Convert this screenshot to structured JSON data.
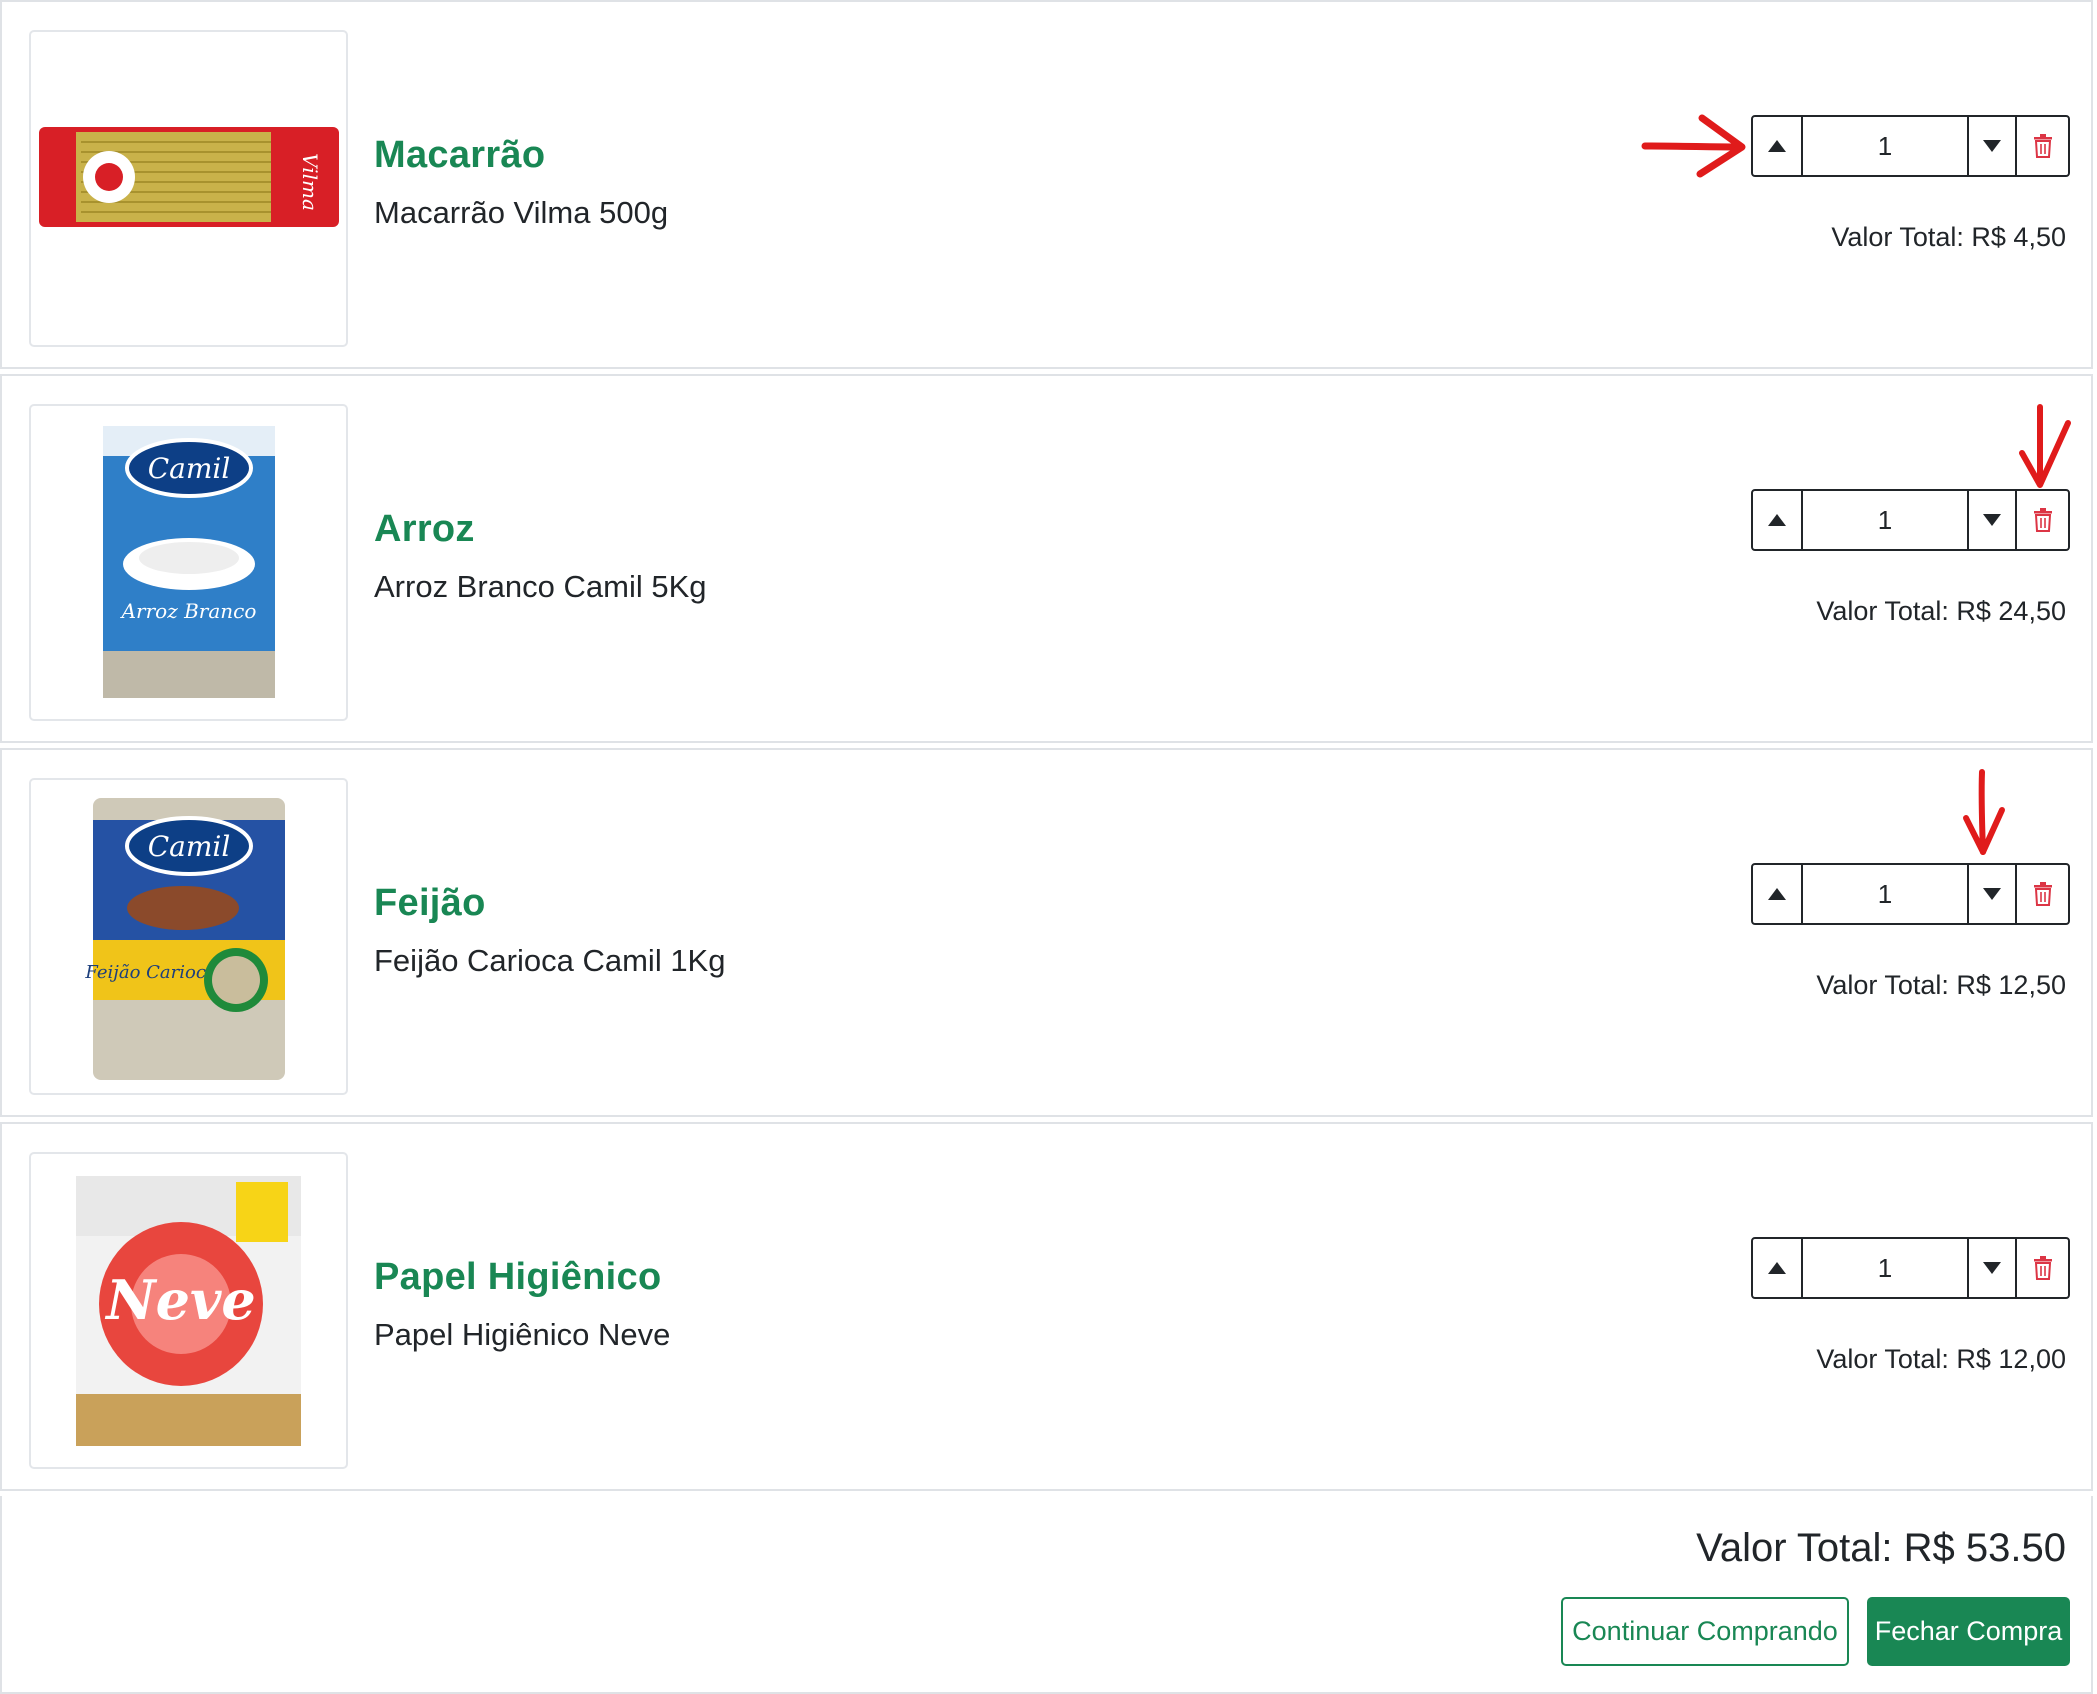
{
  "items": [
    {
      "title": "Macarrão",
      "description": "Macarrão Vilma 500g",
      "quantity": "1",
      "total_label": "Valor Total: R$ 4,50",
      "image_icon": "pasta-package-image"
    },
    {
      "title": "Arroz",
      "description": "Arroz Branco Camil 5Kg",
      "quantity": "1",
      "total_label": "Valor Total: R$ 24,50",
      "image_icon": "rice-package-image"
    },
    {
      "title": "Feijão",
      "description": "Feijão Carioca Camil 1Kg",
      "quantity": "1",
      "total_label": "Valor Total: R$ 12,50",
      "image_icon": "beans-package-image"
    },
    {
      "title": "Papel Higiênico",
      "description": "Papel Higiênico Neve",
      "quantity": "1",
      "total_label": "Valor Total: R$ 12,00",
      "image_icon": "toilet-paper-package-image"
    }
  ],
  "summary": {
    "grand_total": "Valor Total: R$ 53.50",
    "continue_label": "Continuar Comprando",
    "checkout_label": "Fechar Compra"
  },
  "colors": {
    "accent": "#198754",
    "trash": "#dc3545",
    "annotation": "#e01b1b"
  }
}
